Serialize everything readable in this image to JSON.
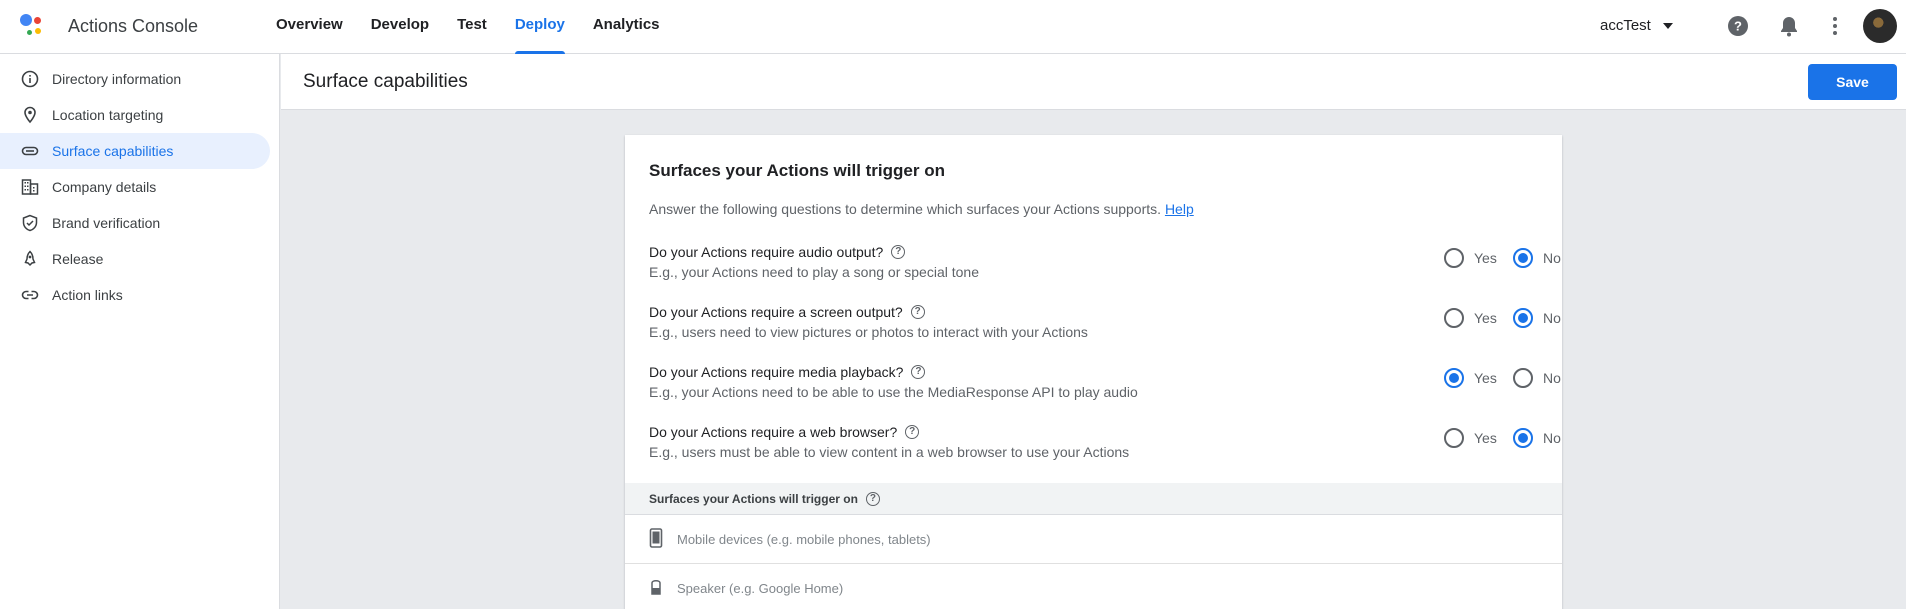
{
  "app": {
    "title": "Actions Console"
  },
  "nav": {
    "tabs": [
      "Overview",
      "Develop",
      "Test",
      "Deploy",
      "Analytics"
    ],
    "active": "Deploy"
  },
  "topbar": {
    "project": "accTest",
    "icons": [
      "help-icon",
      "notifications-icon",
      "more-vert-icon",
      "avatar"
    ]
  },
  "sidebar": {
    "items": [
      {
        "label": "Directory information",
        "icon": "info-icon"
      },
      {
        "label": "Location targeting",
        "icon": "location-pin-icon"
      },
      {
        "label": "Surface capabilities",
        "icon": "surface-icon",
        "active": true
      },
      {
        "label": "Company details",
        "icon": "building-icon"
      },
      {
        "label": "Brand verification",
        "icon": "shield-check-icon"
      },
      {
        "label": "Release",
        "icon": "rocket-icon"
      },
      {
        "label": "Action links",
        "icon": "link-icon"
      }
    ]
  },
  "page": {
    "title": "Surface capabilities",
    "save_label": "Save"
  },
  "card": {
    "title": "Surfaces your Actions will trigger on",
    "description": "Answer the following questions to determine which surfaces your Actions supports.",
    "help_link": "Help",
    "yes_label": "Yes",
    "no_label": "No",
    "questions": [
      {
        "q": "Do your Actions require audio output?",
        "sub": "E.g., your Actions need to play a song or special tone",
        "answer": "No"
      },
      {
        "q": "Do your Actions require a screen output?",
        "sub": "E.g., users need to view pictures or photos to interact with your Actions",
        "answer": "No"
      },
      {
        "q": "Do your Actions require media playback?",
        "sub": "E.g., your Actions need to be able to use the MediaResponse API to play audio",
        "answer": "Yes"
      },
      {
        "q": "Do your Actions require a web browser?",
        "sub": "E.g., users must be able to view content in a web browser to use your Actions",
        "answer": "No"
      }
    ],
    "surfaces_header": "Surfaces your Actions will trigger on",
    "surfaces": [
      {
        "label": "Mobile devices (e.g. mobile phones, tablets)",
        "icon": "phone-icon"
      },
      {
        "label": "Speaker (e.g. Google Home)",
        "icon": "speaker-icon"
      }
    ]
  },
  "colors": {
    "accent": "#1a73e8",
    "background": "#e8eaed"
  }
}
